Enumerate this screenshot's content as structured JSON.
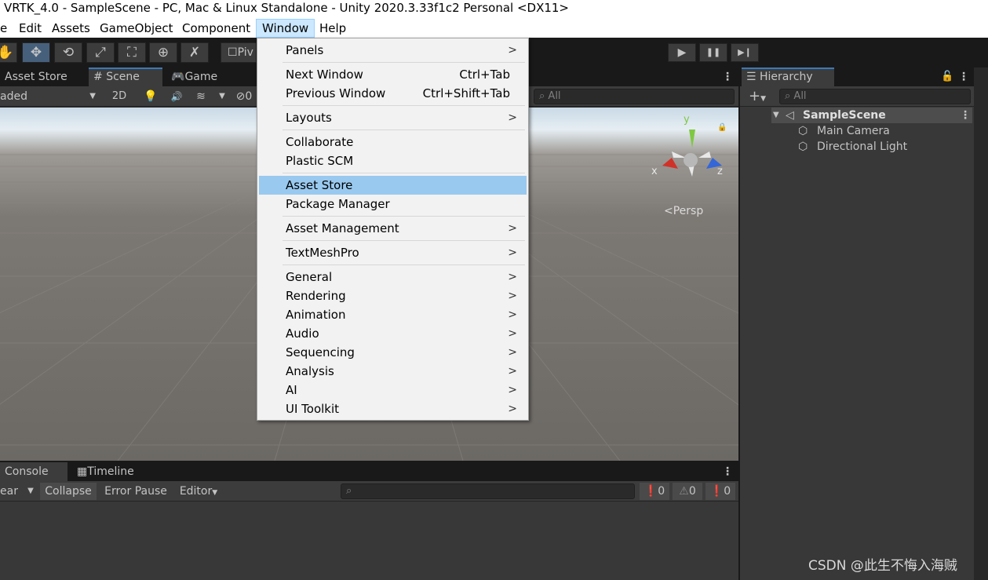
{
  "window": {
    "title": "VRTK_4.0 - SampleScene - PC, Mac & Linux Standalone - Unity 2020.3.33f1c2 Personal <DX11>"
  },
  "menubar": {
    "items": [
      "e",
      "Edit",
      "Assets",
      "GameObject",
      "Component",
      "Window",
      "Help"
    ]
  },
  "toolbar": {
    "tools": [
      "hand-tool-icon",
      "move-tool-icon",
      "rotate-tool-icon",
      "scale-tool-icon",
      "rect-tool-icon",
      "transform-tool-icon",
      "custom-tool-icon"
    ],
    "pivot_label": "Piv",
    "play": "▶",
    "pause": "❚❚",
    "step": "▶❙"
  },
  "scene_tabs": {
    "asset_store": "Asset Store",
    "scene": "Scene",
    "game": "Game"
  },
  "scene_toolbar": {
    "shading": "aded",
    "mode2d": "2D",
    "search_placeholder": "All",
    "hidden_count": "0"
  },
  "gizmo": {
    "y": "y",
    "x": "x",
    "z": "z",
    "persp": "Persp"
  },
  "window_menu": {
    "panels": "Panels",
    "next_window": "Next Window",
    "next_window_shortcut": "Ctrl+Tab",
    "previous_window": "Previous Window",
    "previous_window_shortcut": "Ctrl+Shift+Tab",
    "layouts": "Layouts",
    "collaborate": "Collaborate",
    "plastic_scm": "Plastic SCM",
    "asset_store": "Asset Store",
    "package_manager": "Package Manager",
    "asset_management": "Asset Management",
    "textmeshpro": "TextMeshPro",
    "general": "General",
    "rendering": "Rendering",
    "animation": "Animation",
    "audio": "Audio",
    "sequencing": "Sequencing",
    "analysis": "Analysis",
    "ai": "AI",
    "ui_toolkit": "UI Toolkit"
  },
  "hierarchy": {
    "tab": "Hierarchy",
    "search_placeholder": "All",
    "scene": "SampleScene",
    "objects": [
      "Main Camera",
      "Directional Light"
    ]
  },
  "bottom": {
    "console_tab": "Console",
    "timeline_tab": "Timeline",
    "clear": "ear",
    "collapse": "Collapse",
    "error_pause": "Error Pause",
    "editor": "Editor",
    "info_count": "0",
    "warn_count": "0",
    "error_count": "0"
  },
  "watermark": "CSDN @此生不悔入海贼"
}
